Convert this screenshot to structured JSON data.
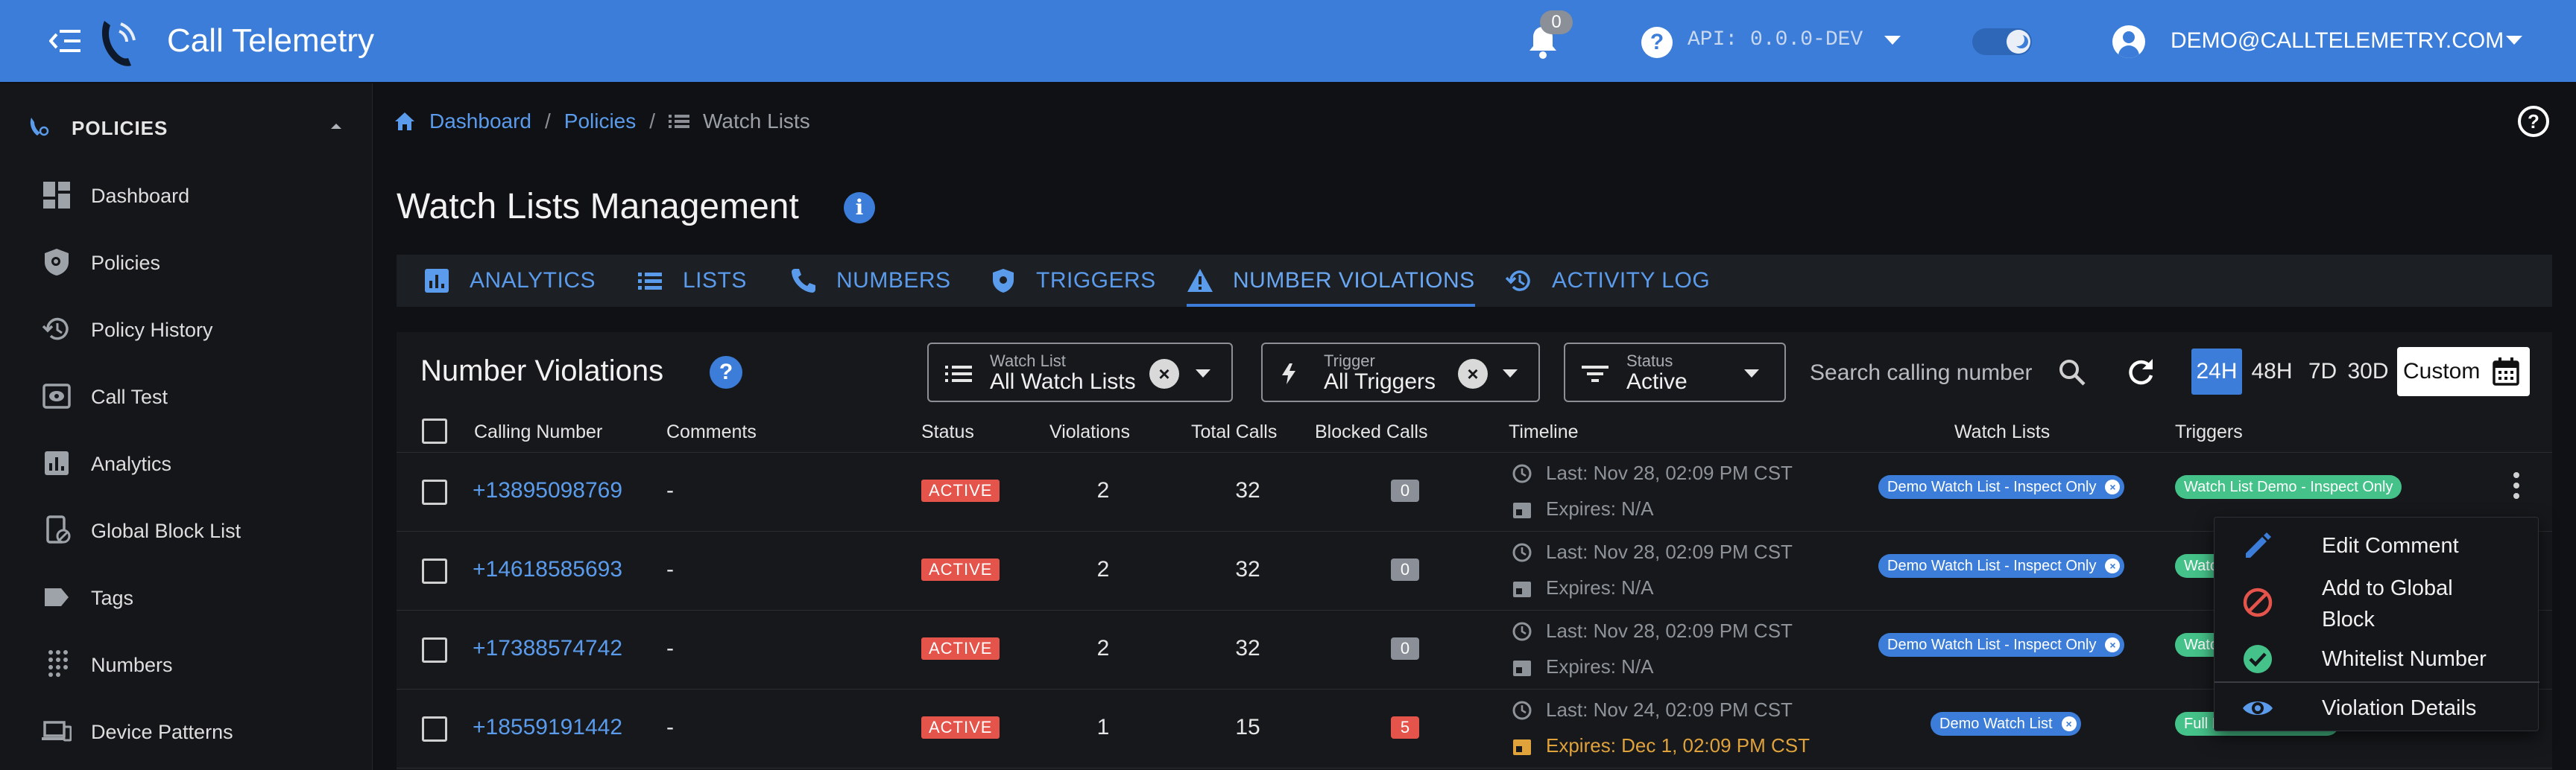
{
  "app": {
    "title": "Call Telemetry"
  },
  "header": {
    "notifications_count": "0",
    "api_label": "API: 0.0.0-DEV",
    "user_email": "DEMO@CALLTELEMETRY.COM"
  },
  "sidebar": {
    "section": "POLICIES",
    "items": [
      {
        "label": "Dashboard",
        "icon": "dashboard-icon"
      },
      {
        "label": "Policies",
        "icon": "shield-search-icon"
      },
      {
        "label": "Policy History",
        "icon": "history-icon"
      },
      {
        "label": "Call Test",
        "icon": "eye-box-icon"
      },
      {
        "label": "Analytics",
        "icon": "analytics-icon"
      },
      {
        "label": "Global Block List",
        "icon": "phone-block-icon"
      },
      {
        "label": "Tags",
        "icon": "tag-icon"
      },
      {
        "label": "Numbers",
        "icon": "dialpad-icon"
      },
      {
        "label": "Device Patterns",
        "icon": "devices-icon"
      }
    ]
  },
  "breadcrumb": {
    "items": [
      "Dashboard",
      "Policies",
      "Watch Lists"
    ],
    "separator": "/"
  },
  "page": {
    "title": "Watch Lists Management",
    "tabs": [
      "ANALYTICS",
      "LISTS",
      "NUMBERS",
      "TRIGGERS",
      "NUMBER VIOLATIONS",
      "ACTIVITY LOG"
    ],
    "active_tab": "NUMBER VIOLATIONS"
  },
  "panel": {
    "title": "Number Violations",
    "filters": {
      "watch_list": {
        "label": "Watch List",
        "value": "All Watch Lists"
      },
      "trigger": {
        "label": "Trigger",
        "value": "All Triggers"
      },
      "status": {
        "label": "Status",
        "value": "Active"
      }
    },
    "search_placeholder": "Search calling number",
    "ranges": [
      "24H",
      "48H",
      "7D",
      "30D"
    ],
    "active_range": "24H",
    "custom_label": "Custom"
  },
  "table": {
    "columns": [
      "Calling Number",
      "Comments",
      "Status",
      "Violations",
      "Total Calls",
      "Blocked Calls",
      "Timeline",
      "Watch Lists",
      "Triggers"
    ],
    "rows": [
      {
        "number": "+13895098769",
        "comment": "-",
        "status": "ACTIVE",
        "violations": "2",
        "total": "32",
        "blocked": "0",
        "last": "Last: Nov 28, 02:09 PM CST",
        "expires": "Expires: N/A",
        "watch_list": "Demo Watch List - Inspect Only",
        "trigger": "Watch List Demo - Inspect Only"
      },
      {
        "number": "+14618585693",
        "comment": "-",
        "status": "ACTIVE",
        "violations": "2",
        "total": "32",
        "blocked": "0",
        "last": "Last: Nov 28, 02:09 PM CST",
        "expires": "Expires: N/A",
        "watch_list": "Demo Watch List - Inspect Only",
        "trigger": "Watch List Demo - Inspect Only"
      },
      {
        "number": "+17388574742",
        "comment": "-",
        "status": "ACTIVE",
        "violations": "2",
        "total": "32",
        "blocked": "0",
        "last": "Last: Nov 28, 02:09 PM CST",
        "expires": "Expires: N/A",
        "watch_list": "Demo Watch List - Inspect Only",
        "trigger": "Watch List Demo - Inspect Only"
      },
      {
        "number": "+18559191442",
        "comment": "-",
        "status": "ACTIVE",
        "violations": "1",
        "total": "15",
        "blocked": "5",
        "last": "Last: Nov 24, 02:09 PM CST",
        "expires": "Expires: Dec 1, 02:09 PM CST",
        "watch_list": "Demo Watch List",
        "trigger": "Full Lockdown Trigger"
      }
    ]
  },
  "context_menu": {
    "items": [
      {
        "label": "Edit Comment",
        "icon": "pencil-icon"
      },
      {
        "label": "Add to Global Block",
        "icon": "block-icon"
      },
      {
        "label": "Whitelist Number",
        "icon": "check-circle-icon"
      },
      {
        "label": "Violation Details",
        "icon": "eye-icon"
      }
    ]
  },
  "colors": {
    "header_bg": "#3b7dd8",
    "accent": "#5b9bec",
    "status_active": "#e5544b",
    "trigger_chip": "#45c289",
    "warning_text": "#e0a23b"
  }
}
